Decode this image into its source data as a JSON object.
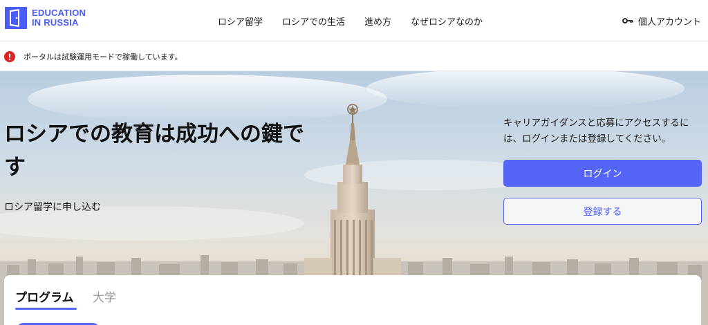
{
  "header": {
    "logo": {
      "line1": "EDUCATION",
      "line2": "IN RUSSIA",
      "color": "#4a5cf5"
    },
    "nav": [
      {
        "label": "ロシア留学"
      },
      {
        "label": "ロシアでの生活"
      },
      {
        "label": "進め方"
      },
      {
        "label": "なぜロシアなのか"
      }
    ],
    "account": {
      "icon": "key-icon",
      "label": "個人アカウント"
    }
  },
  "alert": {
    "icon": "error-icon",
    "color": "#e02424",
    "text": "ポータルは試験運用モードで稼働しています。"
  },
  "hero": {
    "title": "ロシアでの教育は成功への鍵です",
    "subtitle": "ロシア留学に申し込む",
    "auth_prompt": "キャリアガイダンスと応募にアクセスするには、ログインまたは登録してください。",
    "login_label": "ログイン",
    "register_label": "登録する",
    "accent": "#5566f7"
  },
  "search_card": {
    "tabs": [
      {
        "label": "プログラム",
        "active": true
      },
      {
        "label": "大学",
        "active": false
      }
    ]
  }
}
